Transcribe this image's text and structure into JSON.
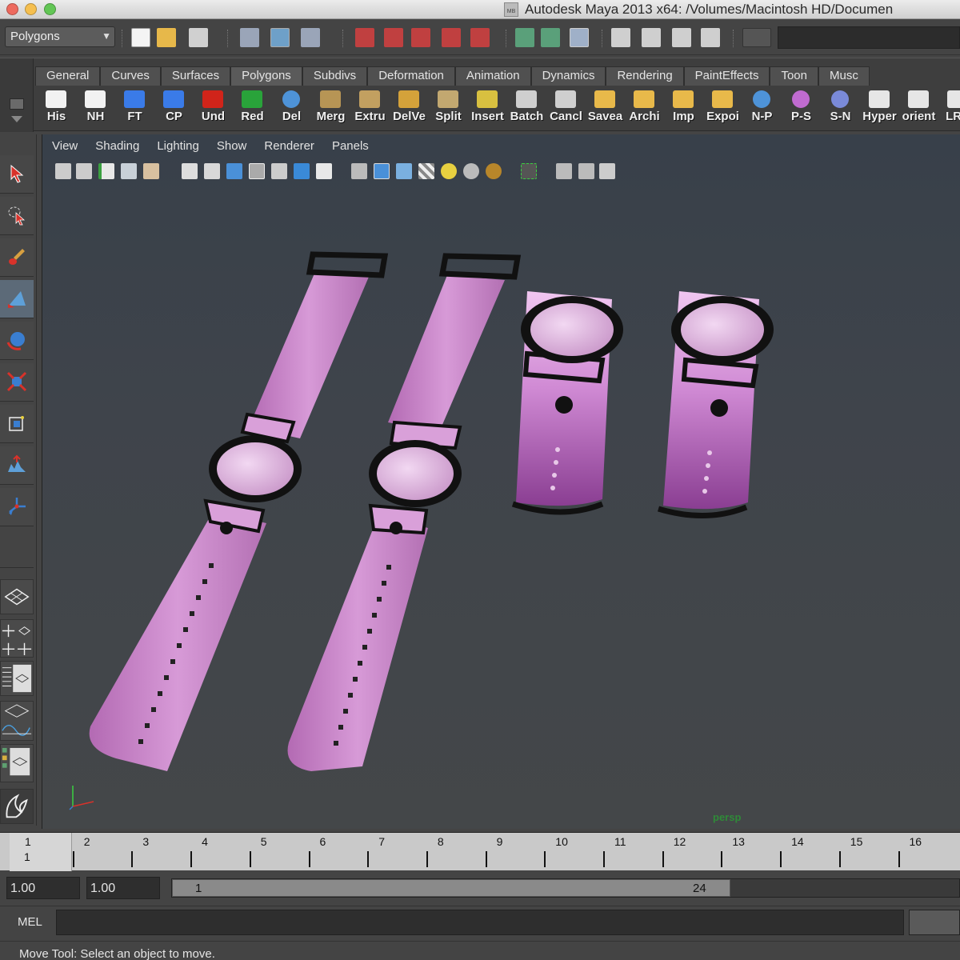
{
  "window": {
    "title": "Autodesk Maya 2013 x64: /Volumes/Macintosh HD/Documen",
    "doc_badge": "MB",
    "traffic_colors": [
      "#ed6a5e",
      "#f5bf4f",
      "#62c655"
    ]
  },
  "statusline": {
    "menu_set": "Polygons",
    "menu_set_arrow": "▼"
  },
  "shelf": {
    "tabs": [
      "General",
      "Curves",
      "Surfaces",
      "Polygons",
      "Subdivs",
      "Deformation",
      "Animation",
      "Dynamics",
      "Rendering",
      "PaintEffects",
      "Toon",
      "Musc"
    ],
    "buttons": [
      {
        "label": "His",
        "icon": "pencil-icon",
        "color": "#f2f2f2"
      },
      {
        "label": "NH",
        "icon": "pencil-icon",
        "color": "#f2f2f2"
      },
      {
        "label": "FT",
        "icon": "axis-icon",
        "color": "#3a7be8"
      },
      {
        "label": "CP",
        "icon": "axis-icon",
        "color": "#3a7be8"
      },
      {
        "label": "Und",
        "icon": "undo-arrow-icon",
        "color": "#d0241a"
      },
      {
        "label": "Red",
        "icon": "redo-arrow-icon",
        "color": "#29a33a"
      },
      {
        "label": "Del",
        "icon": "sphere-icon",
        "color": "#4e93d8"
      },
      {
        "label": "Merg",
        "icon": "mesh-icon",
        "color": "#b79555"
      },
      {
        "label": "Extru",
        "icon": "extrude-icon",
        "color": "#c2a060"
      },
      {
        "label": "DelVe",
        "icon": "vertex-icon",
        "color": "#d4a23a"
      },
      {
        "label": "Split",
        "icon": "split-icon",
        "color": "#c2a870"
      },
      {
        "label": "Insert",
        "icon": "insert-edge-icon",
        "color": "#d8c040"
      },
      {
        "label": "Batch",
        "icon": "clapper-icon",
        "color": "#cfcfcf"
      },
      {
        "label": "Cancl",
        "icon": "clapper-icon",
        "color": "#cfcfcf"
      },
      {
        "label": "Savea",
        "icon": "folder-icon",
        "color": "#e8b94a"
      },
      {
        "label": "Archi",
        "icon": "folder-icon",
        "color": "#e8b94a"
      },
      {
        "label": "Imp",
        "icon": "folder-icon",
        "color": "#e8b94a"
      },
      {
        "label": "Expoi",
        "icon": "folder-icon",
        "color": "#e8b94a"
      },
      {
        "label": "N-P",
        "icon": "sphere-icon",
        "color": "#4e93d8"
      },
      {
        "label": "P-S",
        "icon": "globe-icon",
        "color": "#c06bd0"
      },
      {
        "label": "S-N",
        "icon": "globe-icon",
        "color": "#7a8ad8"
      },
      {
        "label": "Hyper",
        "icon": "window-icon",
        "color": "#e6e6e6"
      },
      {
        "label": "orient",
        "icon": "feather-icon",
        "color": "#e6e6e6"
      },
      {
        "label": "LRA",
        "icon": "eye-icon",
        "color": "#e6e6e6"
      }
    ]
  },
  "viewport": {
    "menus": [
      "View",
      "Shading",
      "Lighting",
      "Show",
      "Renderer",
      "Panels"
    ],
    "camera": "persp",
    "strap_color": "#c887c8",
    "strap_color_light": "#e2b3e2",
    "case_color": "#111111",
    "face_color": "#d9b4da"
  },
  "timeslider": {
    "ticks": [
      "1",
      "2",
      "3",
      "4",
      "5",
      "6",
      "7",
      "8",
      "9",
      "10",
      "11",
      "12",
      "13",
      "14",
      "15",
      "16"
    ],
    "current_frame": "1"
  },
  "rangeslider": {
    "start_time": "1.00",
    "playback_start": "1.00",
    "range_start": "1",
    "range_end": "24"
  },
  "cmdline": {
    "label": "MEL"
  },
  "helpline": {
    "text": "Move Tool: Select an object to move."
  }
}
